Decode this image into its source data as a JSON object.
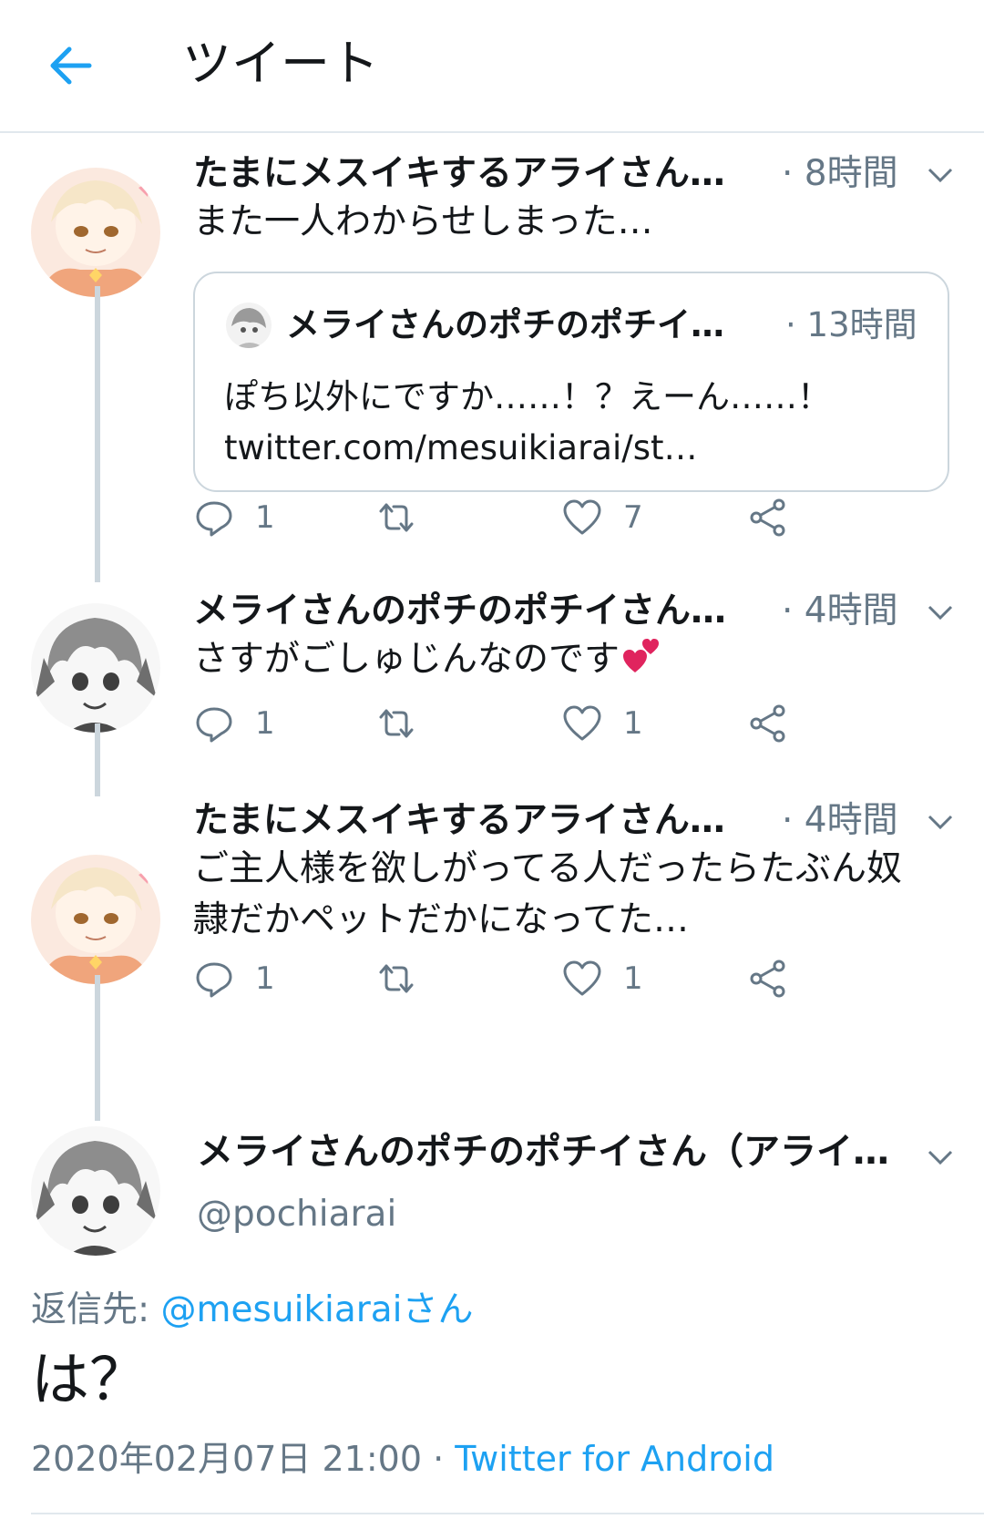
{
  "header": {
    "title": "ツイート",
    "back_icon": "arrow-left-icon"
  },
  "colors": {
    "accent": "#1da1f2",
    "muted": "#657786",
    "border": "#ccd6dd",
    "heart_emoji": "#e0245e"
  },
  "thread": [
    {
      "name": "たまにメスイキするアライさん…",
      "time": "· 8時間",
      "text": "また一人わからせしまった…",
      "quote": {
        "name": "メライさんのポチのポチイ…",
        "time": "· 13時間",
        "text_line1": "ぽち以外にですか……！？えーん……！",
        "text_line2": "twitter.com/mesuikiarai/st…"
      },
      "replies": "1",
      "likes": "7"
    },
    {
      "name": "メライさんのポチのポチイさん…",
      "time": "· 4時間",
      "text": "さすがごしゅじんなのです",
      "emoji": "two-hearts-emoji",
      "replies": "1",
      "likes": "1"
    },
    {
      "name": "たまにメスイキするアライさん…",
      "time": "· 4時間",
      "text_line1": "ご主人様を欲しがってる人だったらたぶん奴",
      "text_line2": "隷だかペットだかになってた…",
      "replies": "1",
      "likes": "1"
    }
  ],
  "main_tweet": {
    "name": "メライさんのポチのポチイさん（アライ…",
    "handle": "@pochiarai",
    "reply_to_label": "返信先: ",
    "reply_to_user": "@mesuikiaraiさん",
    "text": "は？",
    "timestamp": "2020年02月07日 21:00 · ",
    "source": "Twitter for Android"
  }
}
